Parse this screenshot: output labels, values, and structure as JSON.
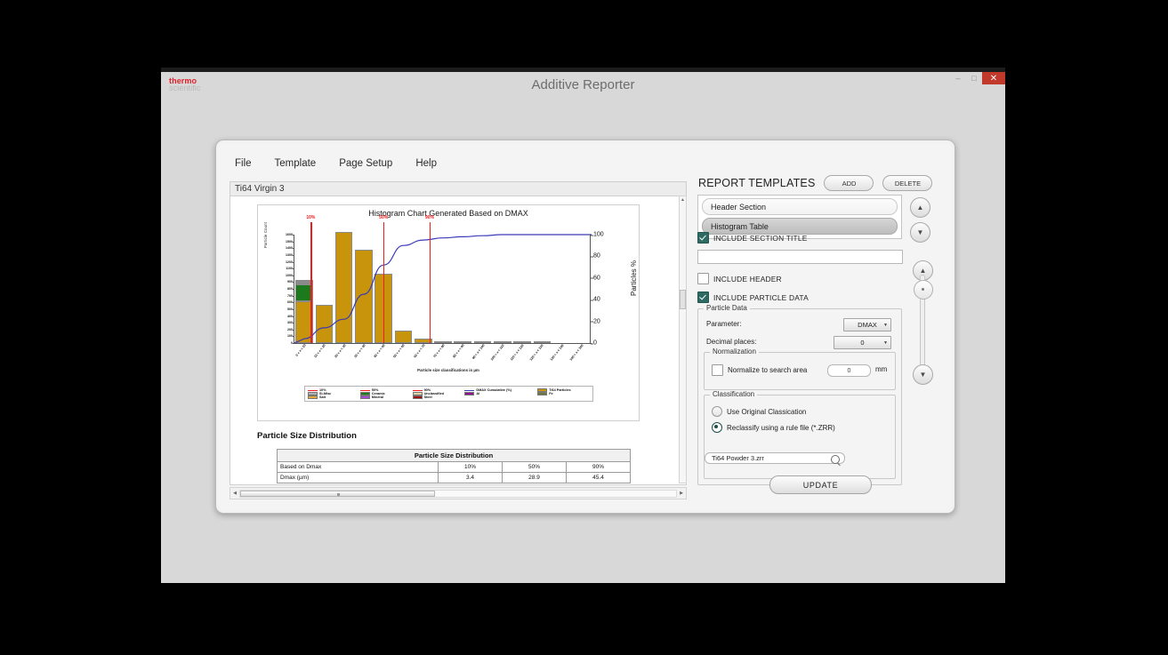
{
  "app": {
    "title": "Additive Reporter",
    "brand_line1": "thermo",
    "brand_line2": "scientific",
    "brand_color": "#e0202a",
    "window_buttons": {
      "minimize": "–",
      "maximize": "□",
      "close": "✕"
    }
  },
  "menu": {
    "items": [
      "File",
      "Template",
      "Page Setup",
      "Help"
    ]
  },
  "preview": {
    "tab_label": "Ti64 Virgin 3",
    "section_heading": "Particle Size Distribution"
  },
  "chart_data": {
    "type": "bar",
    "title": "Histogram Chart Generated Based on DMAX",
    "xlabel": "Particle size classifications in µm",
    "ylabel": "Particle Count",
    "y2label": "Particles %",
    "ylim": [
      0,
      1600
    ],
    "y2lim": [
      0,
      100
    ],
    "yticks": [
      0,
      100,
      200,
      300,
      400,
      500,
      600,
      700,
      800,
      900,
      1000,
      1100,
      1200,
      1300,
      1400,
      1500,
      1600
    ],
    "y2ticks": [
      0,
      20,
      40,
      60,
      80,
      100
    ],
    "grid": false,
    "legend_position": "bottom",
    "categories": [
      "0 < x < 10",
      "10 < x < 20",
      "20 < x < 30",
      "30 < x < 40",
      "40 < x < 50",
      "50 < x < 60",
      "60 < x < 70",
      "70 < x < 80",
      "80 < x < 90",
      "90 < x < 100",
      "100 < x < 110",
      "110 < x < 120",
      "120 < x < 130",
      "130 < x < 140",
      "140 < x < 150"
    ],
    "series": [
      {
        "name": "Ti64 Particles",
        "color": "#c8940b",
        "values": [
          620,
          570,
          1640,
          1380,
          1020,
          190,
          60,
          15,
          8,
          4,
          2,
          1,
          1,
          0,
          0
        ]
      },
      {
        "name": "Ceramic",
        "color": "#1c7a1c",
        "values": [
          250,
          0,
          0,
          0,
          0,
          0,
          0,
          0,
          0,
          0,
          0,
          0,
          0,
          0,
          0
        ]
      },
      {
        "name": "Si-Misc",
        "color": "#8a8a8a",
        "values": [
          60,
          0,
          0,
          0,
          0,
          0,
          0,
          0,
          0,
          0,
          0,
          0,
          0,
          0,
          0
        ]
      }
    ],
    "cumulative": {
      "name": "DMAX Cumulative (%)",
      "color": "#3a3ab8",
      "values": [
        4,
        14,
        22,
        45,
        72,
        90,
        95,
        97,
        98,
        99,
        100,
        100,
        100,
        100,
        100
      ]
    },
    "markers": [
      {
        "label": "10%",
        "x_frac": 0.055,
        "color": "#f21b1b"
      },
      {
        "label": "50%",
        "x_frac": 0.3,
        "color": "#f21b1b"
      },
      {
        "label": "90%",
        "x_frac": 0.455,
        "color": "#f21b1b"
      }
    ],
    "legend": [
      {
        "label": "10%",
        "color": "#f21b1b",
        "style": "line"
      },
      {
        "label": "50%",
        "color": "#f21b1b",
        "style": "line"
      },
      {
        "label": "90%",
        "color": "#f21b1b",
        "style": "line"
      },
      {
        "label": "DMAX Cumulative (%)",
        "color": "#3a3ab8",
        "style": "line"
      },
      {
        "label": "Ti64 Particles",
        "color": "#c8940b",
        "style": "swatch"
      },
      {
        "label": "Si-Misc",
        "color": "#b0b0b0",
        "style": "swatch"
      },
      {
        "label": "Ceramic",
        "color": "#1c7a1c",
        "style": "swatch"
      },
      {
        "label": "Unclassified",
        "color": "#ddd5a8",
        "style": "swatch"
      },
      {
        "label": "Al",
        "color": "#8c0f8c",
        "style": "swatch"
      },
      {
        "label": "Fe",
        "color": "#6b7a3a",
        "style": "swatch"
      },
      {
        "label": "Salt",
        "color": "#e3a73c",
        "style": "swatch"
      },
      {
        "label": "Mineral",
        "color": "#a24bd4",
        "style": "swatch"
      },
      {
        "label": "Steel",
        "color": "#9c1212",
        "style": "swatch"
      }
    ]
  },
  "psd_table": {
    "caption": "Particle Size Distribution",
    "rows": [
      {
        "label": "Based on Dmax",
        "values": [
          "10%",
          "50%",
          "90%"
        ]
      },
      {
        "label": "Dmax (µm)",
        "values": [
          "3.4",
          "28.9",
          "45.4"
        ]
      }
    ]
  },
  "right_panel": {
    "title": "REPORT TEMPLATES",
    "add_label": "ADD",
    "delete_label": "DELETE",
    "templates": [
      {
        "label": "Header Section",
        "selected": false
      },
      {
        "label": "Histogram Table",
        "selected": true
      }
    ],
    "include_section_title": {
      "label": "INCLUDE SECTION TITLE",
      "checked": true
    },
    "section_title_value": "",
    "include_header": {
      "label": "INCLUDE HEADER",
      "checked": false
    },
    "include_particle_data": {
      "label": "INCLUDE PARTICLE DATA",
      "checked": true
    },
    "particle_data": {
      "group_label": "Particle Data",
      "parameter_label": "Parameter:",
      "parameter_value": "DMAX",
      "decimal_label": "Decimal places:",
      "decimal_value": "0"
    },
    "normalization": {
      "group_label": "Normalization",
      "checkbox_label": "Normalize to search area",
      "checked": false,
      "value": "0",
      "unit": "mm"
    },
    "classification": {
      "group_label": "Classification",
      "option_original": "Use Original Classication",
      "option_rule": "Reclassify using a rule file (*.ZRR)",
      "selected": "rule",
      "rule_file": "Ti64 Powder 3.zrr"
    },
    "update_label": "UPDATE",
    "scroll_up": "▲",
    "scroll_down": "▼"
  }
}
